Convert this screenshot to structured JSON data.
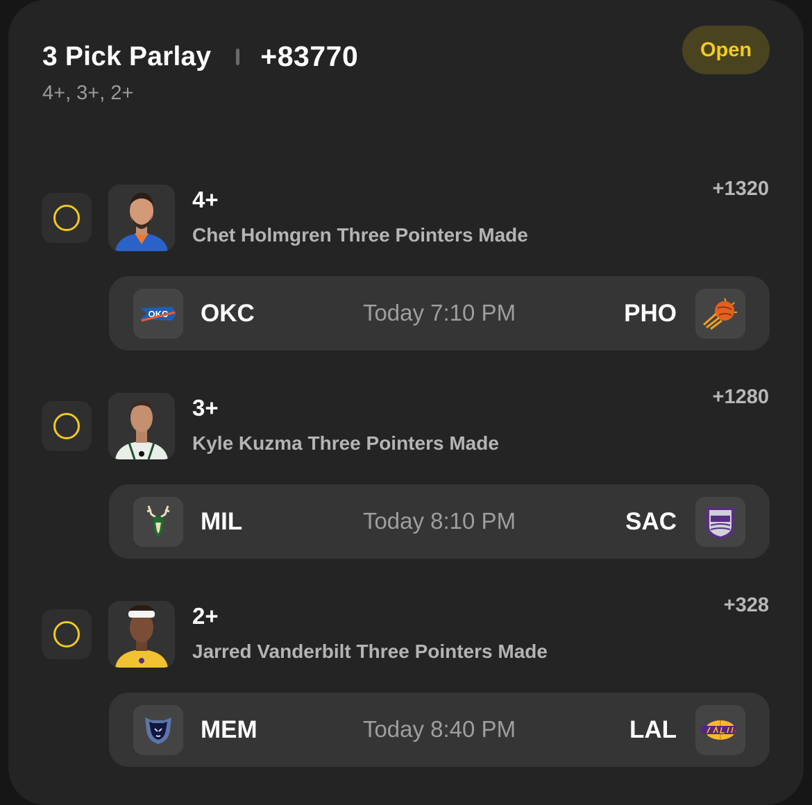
{
  "parlay": {
    "title": "3 Pick Parlay",
    "odds": "+83770",
    "subtitle": "4+, 3+, 2+",
    "status": "Open",
    "accent_color": "#f2cb1d"
  },
  "picks": [
    {
      "threshold": "4+",
      "market": "Chet Holmgren Three Pointers Made",
      "odds": "+1320",
      "avatar_icon": "player-headshot-icon",
      "game": {
        "away_team": "OKC",
        "home_team": "PHO",
        "time": "Today 7:10 PM",
        "away_logo": "thunder-logo-icon",
        "home_logo": "suns-logo-icon"
      }
    },
    {
      "threshold": "3+",
      "market": "Kyle Kuzma Three Pointers Made",
      "odds": "+1280",
      "avatar_icon": "player-headshot-icon",
      "game": {
        "away_team": "MIL",
        "home_team": "SAC",
        "time": "Today 8:10 PM",
        "away_logo": "bucks-logo-icon",
        "home_logo": "kings-logo-icon"
      }
    },
    {
      "threshold": "2+",
      "market": "Jarred Vanderbilt Three Pointers Made",
      "odds": "+328",
      "avatar_icon": "player-headshot-icon",
      "game": {
        "away_team": "MEM",
        "home_team": "LAL",
        "time": "Today 8:40 PM",
        "away_logo": "grizzlies-logo-icon",
        "home_logo": "lakers-logo-icon"
      }
    }
  ]
}
